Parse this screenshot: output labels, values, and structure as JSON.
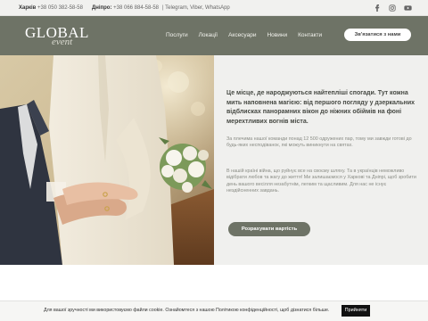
{
  "topbar": {
    "city1": "Харків",
    "phone1": "+38 050 382-58-58",
    "city2": "Дніпро:",
    "phone2": "+38 066 884-58-58",
    "messengers": "| Telegram, Viber, WhatsApp",
    "socials": [
      {
        "icon": "facebook-icon"
      },
      {
        "icon": "instagram-icon"
      },
      {
        "icon": "youtube-icon"
      }
    ]
  },
  "header": {
    "logo_main": "GLOBAL",
    "logo_sub": "event",
    "nav": [
      "Послуги",
      "Локації",
      "Аксесуари",
      "Новини",
      "Контакти"
    ],
    "cta": "Зв'язатися з нами"
  },
  "hero": {
    "headline": "Це місце, де народжуються найтепліші спогади. Тут кожна мить наповнена магією: від першого погляду у дзеркальних відблисках панорамних вікон до ніжних обіймів на фоні мерехтливих вогнів міста.",
    "para1": "За плечима нашої команди понад 12 500 одружених пар, тому ми завжди готові до будь-яких несподіванок, які можуть виникнути на святах.",
    "para2": "В нашій країні війна, що руйнує все на своєму шляху. Та в українців неможливо відібрати любов та жагу до життя! Ми залишаємося у Харкові та Дніпрі, щоб зробити день вашого весілля незабутнім, легким та щасливим. Для нас не існує нездійсненних завдань.",
    "button": "Розрахувати вартість"
  },
  "cookie": {
    "text": "Для вашої зручності ми використовуємо файли cookie. Ознайомтеся з нашою Політикою конфіденційності, щоб дізнатися більше.",
    "button": "Прийняти"
  },
  "colors": {
    "header_bg": "#6e7366",
    "content_bg": "#f0f0ee",
    "text_dark": "#464943",
    "text_muted": "#8a8c85"
  }
}
